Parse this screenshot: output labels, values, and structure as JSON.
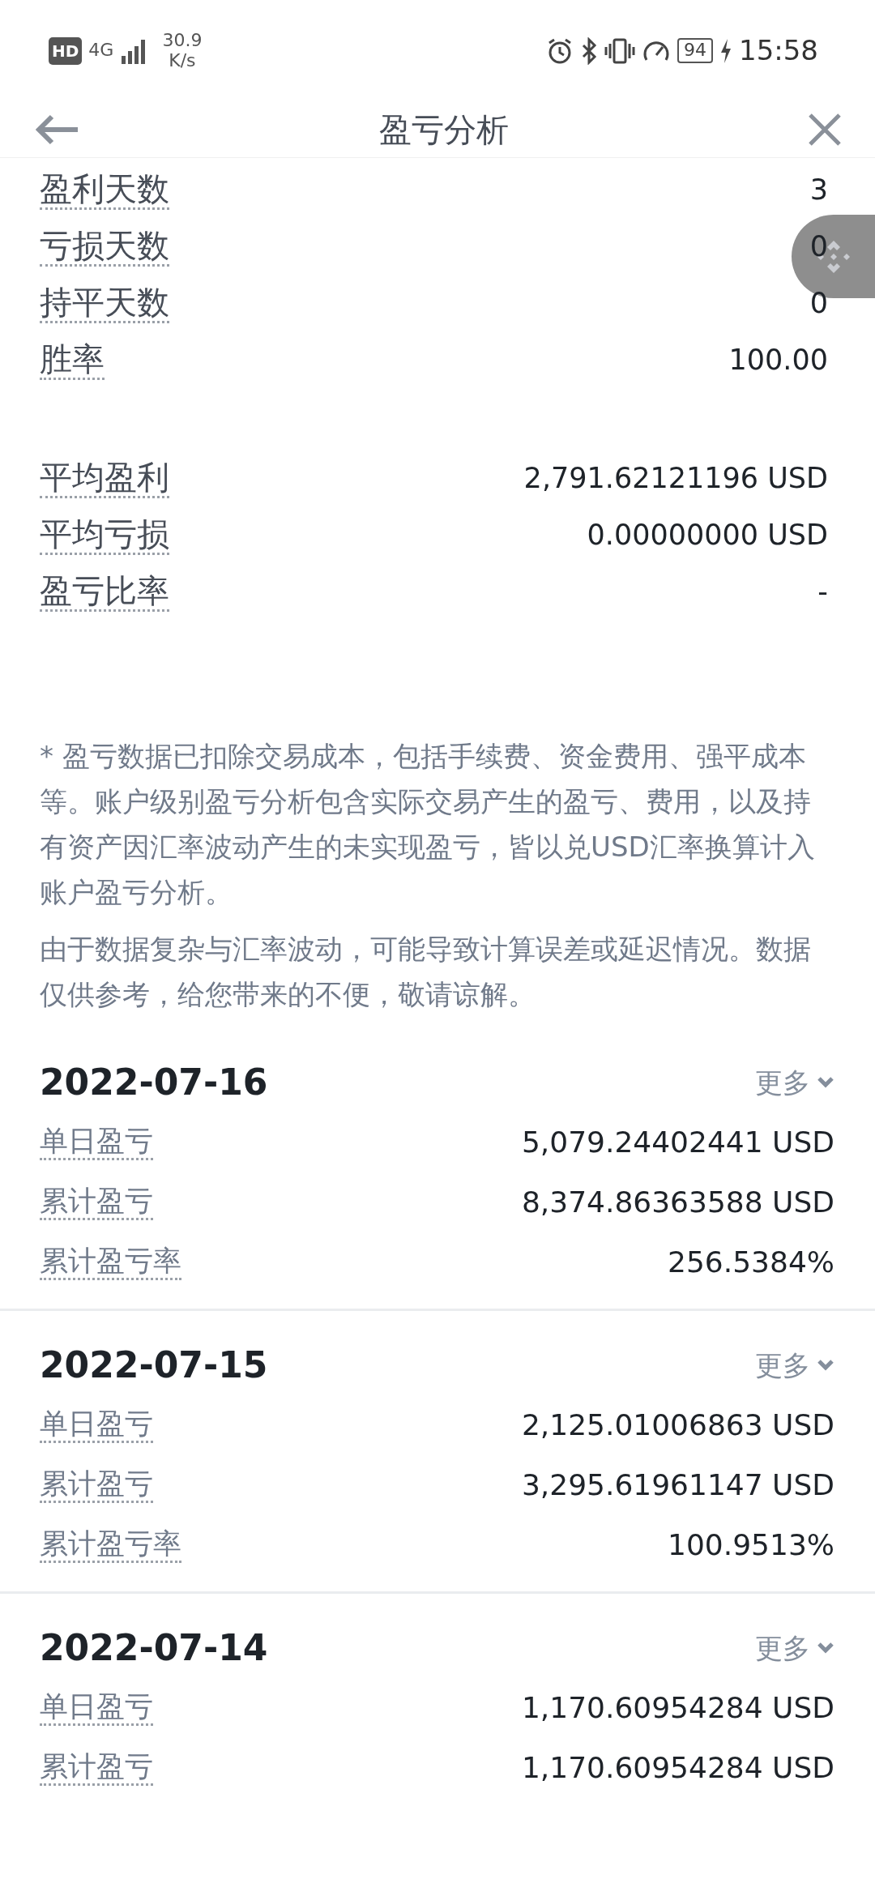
{
  "status_bar": {
    "hd": "HD",
    "network": "4G",
    "speed": "30.9",
    "speed_unit": "K/s",
    "battery": "94",
    "time": "15:58"
  },
  "header": {
    "title": "盈亏分析"
  },
  "stats_groups": [
    [
      {
        "label": "盈利天数",
        "value": "3"
      },
      {
        "label": "亏损天数",
        "value": "0"
      },
      {
        "label": "持平天数",
        "value": "0"
      },
      {
        "label": "胜率",
        "value": "100.00"
      }
    ],
    [
      {
        "label": "平均盈利",
        "value": "2,791.62121196 USD"
      },
      {
        "label": "平均亏损",
        "value": "0.00000000 USD"
      },
      {
        "label": "盈亏比率",
        "value": "-"
      }
    ]
  ],
  "notes": [
    "* 盈亏数据已扣除交易成本，包括手续费、资金费用、强平成本等。账户级别盈亏分析包含实际交易产生的盈亏、费用，以及持有资产因汇率波动产生的未实现盈亏，皆以兑USD汇率换算计入账户盈亏分析。",
    "由于数据复杂与汇率波动，可能导致计算误差或延迟情况。数据仅供参考，给您带来的不便，敬请谅解。"
  ],
  "days": [
    {
      "date": "2022-07-16",
      "more": "更多",
      "expanded": false,
      "rows": [
        {
          "label": "单日盈亏",
          "value": "5,079.24402441 USD"
        },
        {
          "label": "累计盈亏",
          "value": "8,374.86363588 USD"
        },
        {
          "label": "累计盈亏率",
          "value": "256.5384%"
        }
      ]
    },
    {
      "date": "2022-07-15",
      "more": "更多",
      "expanded": false,
      "rows": [
        {
          "label": "单日盈亏",
          "value": "2,125.01006863 USD"
        },
        {
          "label": "累计盈亏",
          "value": "3,295.61961147 USD"
        },
        {
          "label": "累计盈亏率",
          "value": "100.9513%"
        }
      ]
    },
    {
      "date": "2022-07-14",
      "more": "更多",
      "expanded": false,
      "rows": [
        {
          "label": "单日盈亏",
          "value": "1,170.60954284 USD"
        },
        {
          "label": "累计盈亏",
          "value": "1,170.60954284 USD"
        }
      ]
    }
  ]
}
